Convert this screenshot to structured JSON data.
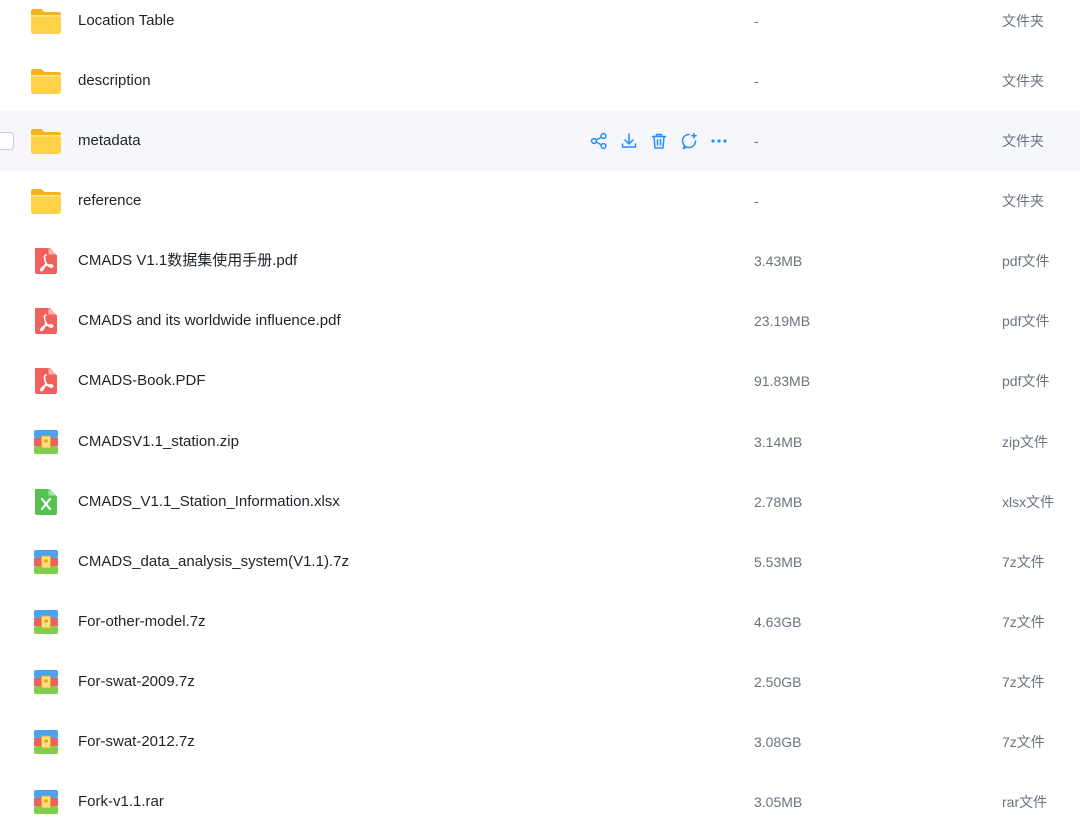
{
  "accent_color": "#1e90ff",
  "row_actions": {
    "share_icon": "share-icon",
    "download_icon": "download-icon",
    "delete_icon": "trash-icon",
    "comment_icon": "comment-icon",
    "more_icon": "more-icon"
  },
  "files": [
    {
      "name": "Location Table",
      "size": "-",
      "type": "文件夹",
      "icon": "folder-icon"
    },
    {
      "name": "description",
      "size": "-",
      "type": "文件夹",
      "icon": "folder-icon"
    },
    {
      "name": "metadata",
      "size": "-",
      "type": "文件夹",
      "icon": "folder-icon",
      "hovered": true
    },
    {
      "name": "reference",
      "size": "-",
      "type": "文件夹",
      "icon": "folder-icon"
    },
    {
      "name": "CMADS V1.1数据集使用手册.pdf",
      "size": "3.43MB",
      "type": "pdf文件",
      "icon": "pdf-icon"
    },
    {
      "name": "CMADS and its worldwide influence.pdf",
      "size": "23.19MB",
      "type": "pdf文件",
      "icon": "pdf-icon"
    },
    {
      "name": "CMADS-Book.PDF",
      "size": "91.83MB",
      "type": "pdf文件",
      "icon": "pdf-icon"
    },
    {
      "name": "CMADSV1.1_station.zip",
      "size": "3.14MB",
      "type": "zip文件",
      "icon": "archive-icon"
    },
    {
      "name": "CMADS_V1.1_Station_Information.xlsx",
      "size": "2.78MB",
      "type": "xlsx文件",
      "icon": "excel-icon"
    },
    {
      "name": "CMADS_data_analysis_system(V1.1).7z",
      "size": "5.53MB",
      "type": "7z文件",
      "icon": "archive-icon"
    },
    {
      "name": "For-other-model.7z",
      "size": "4.63GB",
      "type": "7z文件",
      "icon": "archive-icon"
    },
    {
      "name": "For-swat-2009.7z",
      "size": "2.50GB",
      "type": "7z文件",
      "icon": "archive-icon"
    },
    {
      "name": "For-swat-2012.7z",
      "size": "3.08GB",
      "type": "7z文件",
      "icon": "archive-icon"
    },
    {
      "name": "Fork-v1.1.rar",
      "size": "3.05MB",
      "type": "rar文件",
      "icon": "archive-icon"
    }
  ]
}
